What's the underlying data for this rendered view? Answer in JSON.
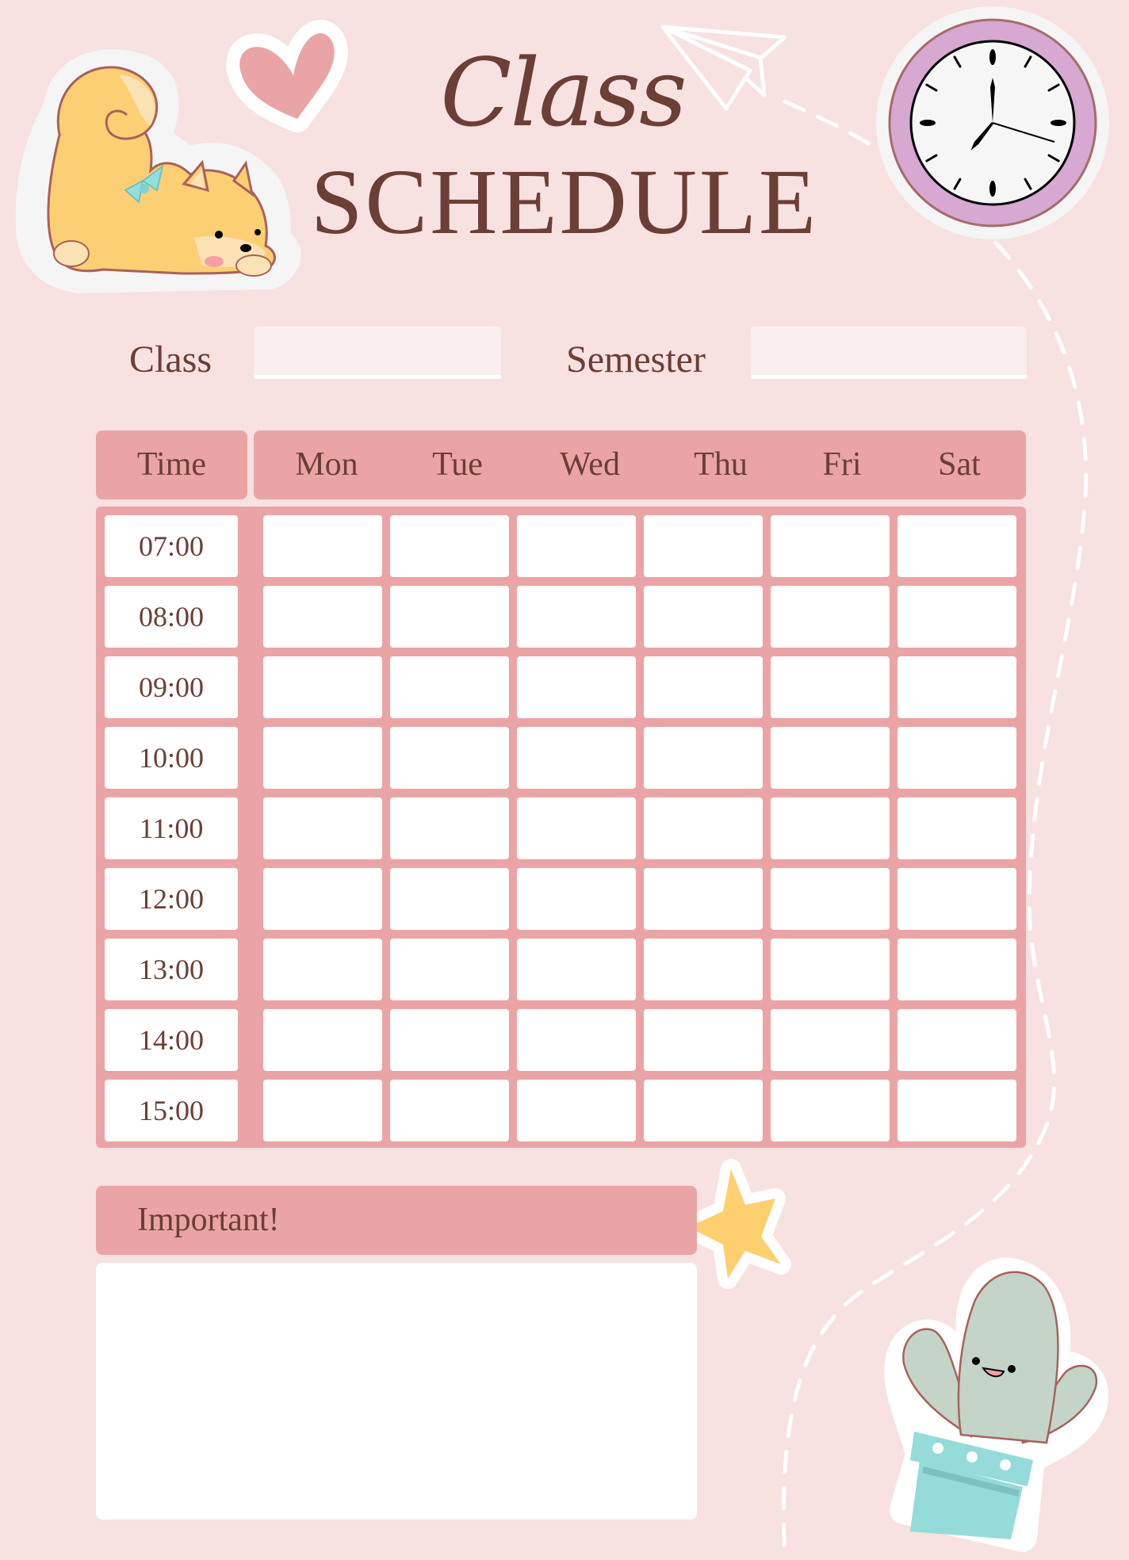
{
  "title": {
    "script": "Class",
    "main": "SCHEDULE"
  },
  "form": {
    "class_label": "Class",
    "class_value": "",
    "semester_label": "Semester",
    "semester_value": ""
  },
  "table": {
    "time_header": "Time",
    "days": [
      "Mon",
      "Tue",
      "Wed",
      "Thu",
      "Fri",
      "Sat"
    ],
    "times": [
      "07:00",
      "08:00",
      "09:00",
      "10:00",
      "11:00",
      "12:00",
      "13:00",
      "14:00",
      "15:00"
    ]
  },
  "notes": {
    "header": "Important!",
    "value": ""
  },
  "decorations": {
    "top_left": "shiba-dog-sticker",
    "top_left_small": "heart-sticker",
    "top_right": "clock-sticker",
    "top_center": "paper-plane-outline",
    "bottom_right": "cactus-sticker",
    "bottom_middle": "star-sticker",
    "clock_time": "7:17"
  },
  "colors": {
    "background": "#f7e1e1",
    "accent": "#eba4a5",
    "text": "#6b3f35",
    "field": "#fbeeee",
    "clock_ring": "#d6a8d2",
    "star": "#fdcf6f",
    "cactus": "#c4d4c8",
    "pot": "#94dbd9"
  }
}
